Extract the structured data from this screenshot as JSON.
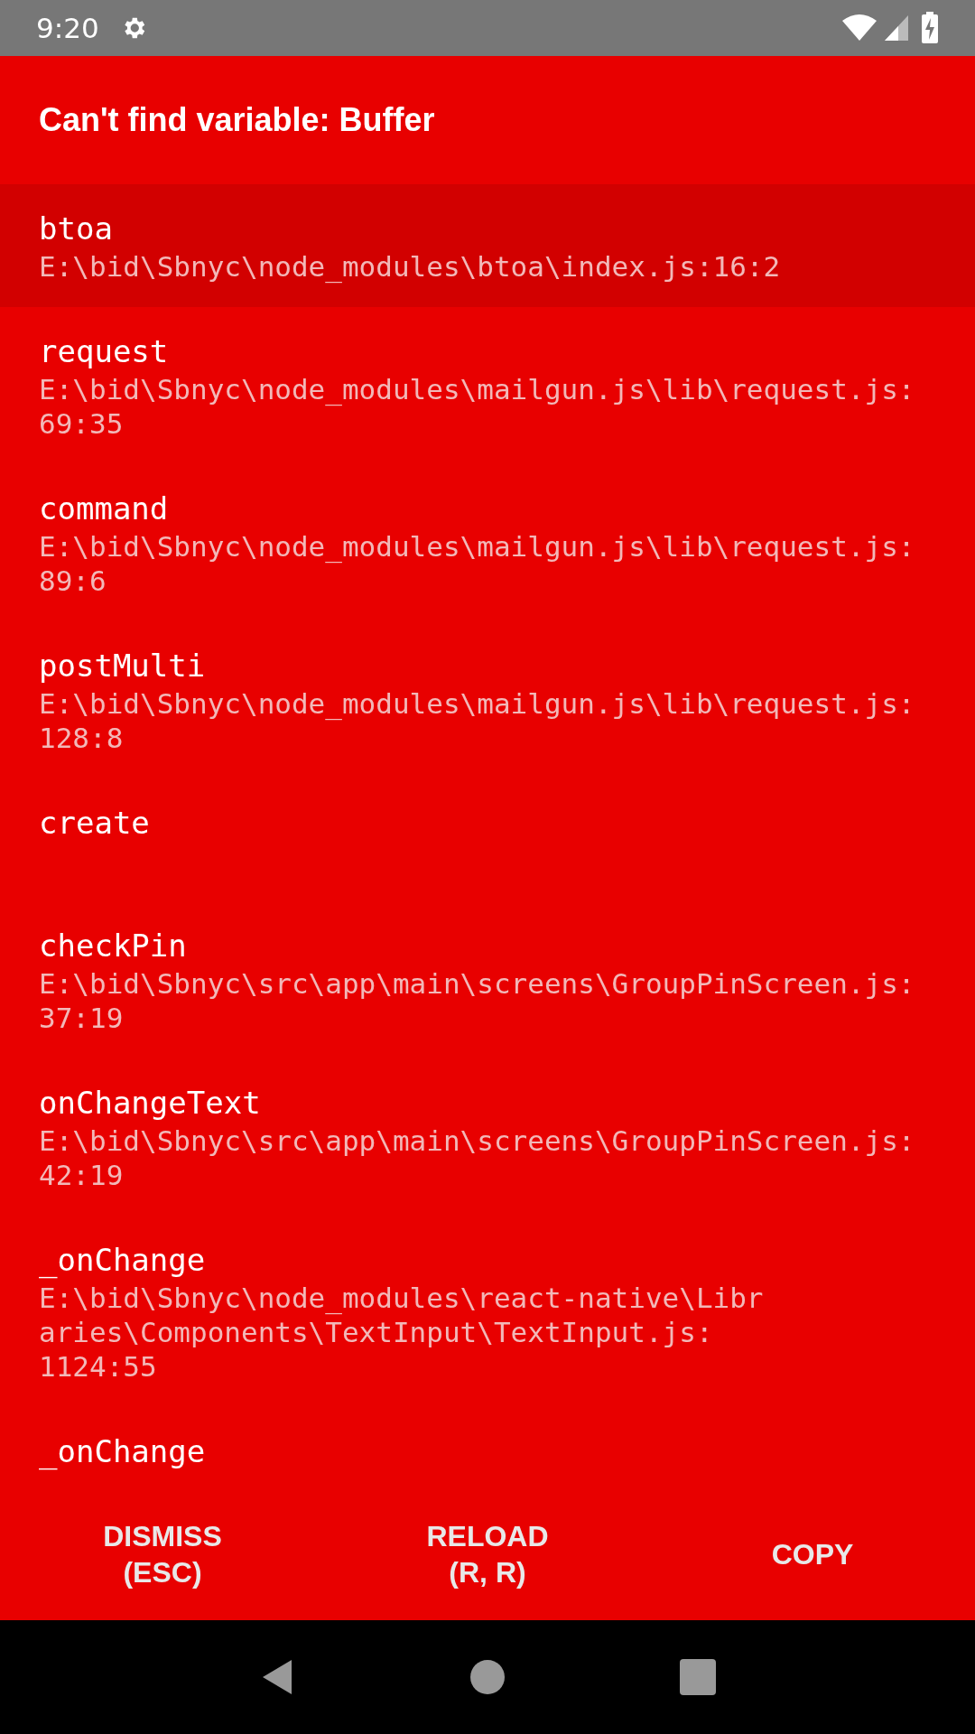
{
  "status_bar": {
    "time": "9:20"
  },
  "error": {
    "title": "Can't find variable: Buffer"
  },
  "stack": [
    {
      "name": "btoa",
      "selected": true,
      "location": [
        "E:\\bid\\Sbnyc\\node_modules\\btoa\\index.js:16:2"
      ]
    },
    {
      "name": "request",
      "selected": false,
      "location": [
        "E:\\bid\\Sbnyc\\node_modules\\mailgun.js\\lib\\request.js:",
        "69:35"
      ]
    },
    {
      "name": "command",
      "selected": false,
      "location": [
        "E:\\bid\\Sbnyc\\node_modules\\mailgun.js\\lib\\request.js:",
        "89:6"
      ]
    },
    {
      "name": "postMulti",
      "selected": false,
      "location": [
        "E:\\bid\\Sbnyc\\node_modules\\mailgun.js\\lib\\request.js:",
        "128:8"
      ]
    },
    {
      "name": "create",
      "selected": false
    },
    {
      "name": "checkPin",
      "selected": false,
      "location": [
        "E:\\bid\\Sbnyc\\src\\app\\main\\screens\\GroupPinScreen.js:",
        "37:19"
      ]
    },
    {
      "name": "onChangeText",
      "selected": false,
      "location": [
        "E:\\bid\\Sbnyc\\src\\app\\main\\screens\\GroupPinScreen.js:",
        "42:19"
      ]
    },
    {
      "name": "_onChange",
      "selected": false,
      "location": [
        "E:\\bid\\Sbnyc\\node_modules\\react-native\\Libr",
        "aries\\Components\\TextInput\\TextInput.js:",
        "1124:55"
      ]
    },
    {
      "name": "_onChange",
      "selected": false
    }
  ],
  "buttons": [
    {
      "label": [
        "DISMISS",
        "(ESC)"
      ]
    },
    {
      "label": [
        "RELOAD",
        "(R, R)"
      ]
    },
    {
      "label": [
        "COPY"
      ]
    }
  ]
}
